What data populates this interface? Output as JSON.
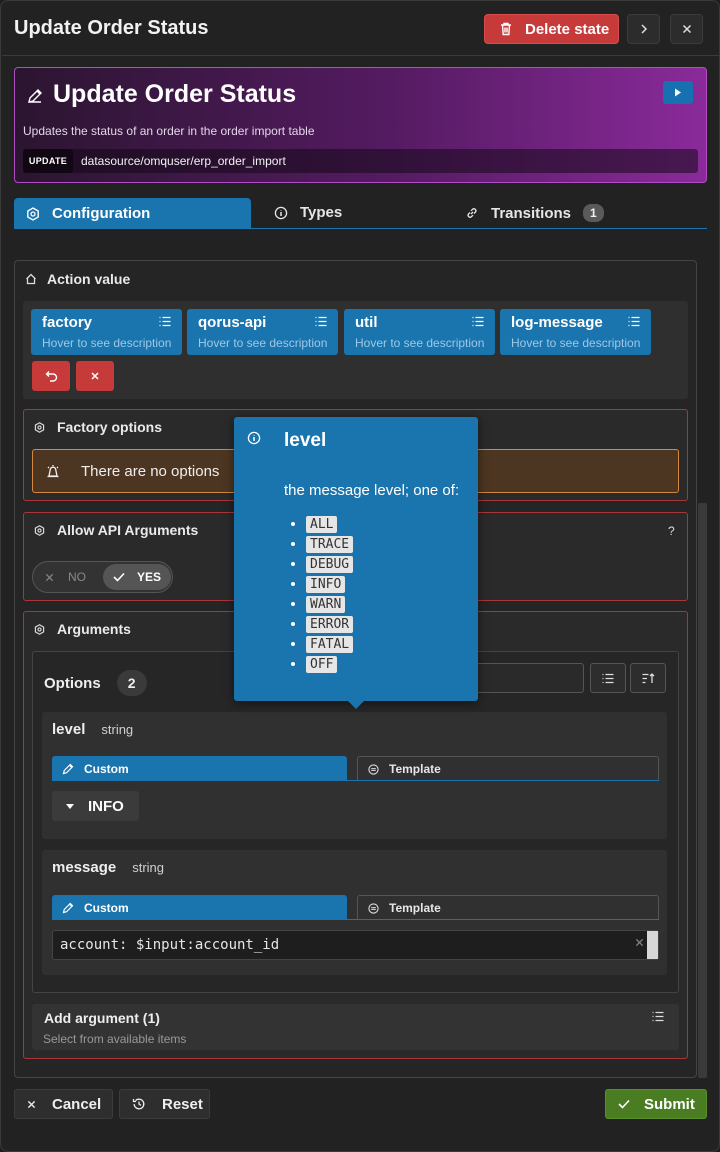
{
  "window": {
    "title": "Update Order Status",
    "delete_label": "Delete state"
  },
  "banner": {
    "title": "Update Order Status",
    "description": "Updates the status of an order in the order import table",
    "tag": "UPDATE",
    "path": "datasource/omquser/erp_order_import",
    "color_from": "#2b1530",
    "color_to": "#8a2a9a"
  },
  "tabs": [
    {
      "label": "Configuration",
      "active": true
    },
    {
      "label": "Types"
    },
    {
      "label": "Transitions",
      "badge": "1"
    }
  ],
  "action": {
    "title": "Action value",
    "chips": [
      {
        "name": "factory",
        "description": "Hover to see description"
      },
      {
        "name": "qorus-api",
        "description": "Hover to see description"
      },
      {
        "name": "util",
        "description": "Hover to see description"
      },
      {
        "name": "log-message",
        "description": "Hover to see description"
      }
    ]
  },
  "factory_options": {
    "title": "Factory options",
    "message": "There are no options"
  },
  "api_args": {
    "title": "Allow API Arguments",
    "help": "?",
    "no_label": "NO",
    "yes_label": "YES",
    "value": "YES"
  },
  "arguments": {
    "title": "Arguments",
    "options_label": "Options",
    "options_count": "2",
    "items": [
      {
        "name": "level",
        "type": "string",
        "custom_tab": "Custom",
        "template_tab": "Template",
        "value": "INFO"
      },
      {
        "name": "message",
        "type": "string",
        "custom_tab": "Custom",
        "template_tab": "Template",
        "value": "account: $input:account_id"
      }
    ],
    "add_title": "Add argument (1)",
    "add_subtitle": "Select from available items"
  },
  "tooltip": {
    "title": "level",
    "description": "the message level; one of:",
    "levels": [
      "ALL",
      "TRACE",
      "DEBUG",
      "INFO",
      "WARN",
      "ERROR",
      "FATAL",
      "OFF"
    ]
  },
  "footer": {
    "cancel": "Cancel",
    "reset": "Reset",
    "submit": "Submit"
  },
  "colors": {
    "primary": "#1a74ae",
    "danger": "#c73a3a",
    "success": "#4a7d22",
    "warning_bg": "#4d3621"
  }
}
